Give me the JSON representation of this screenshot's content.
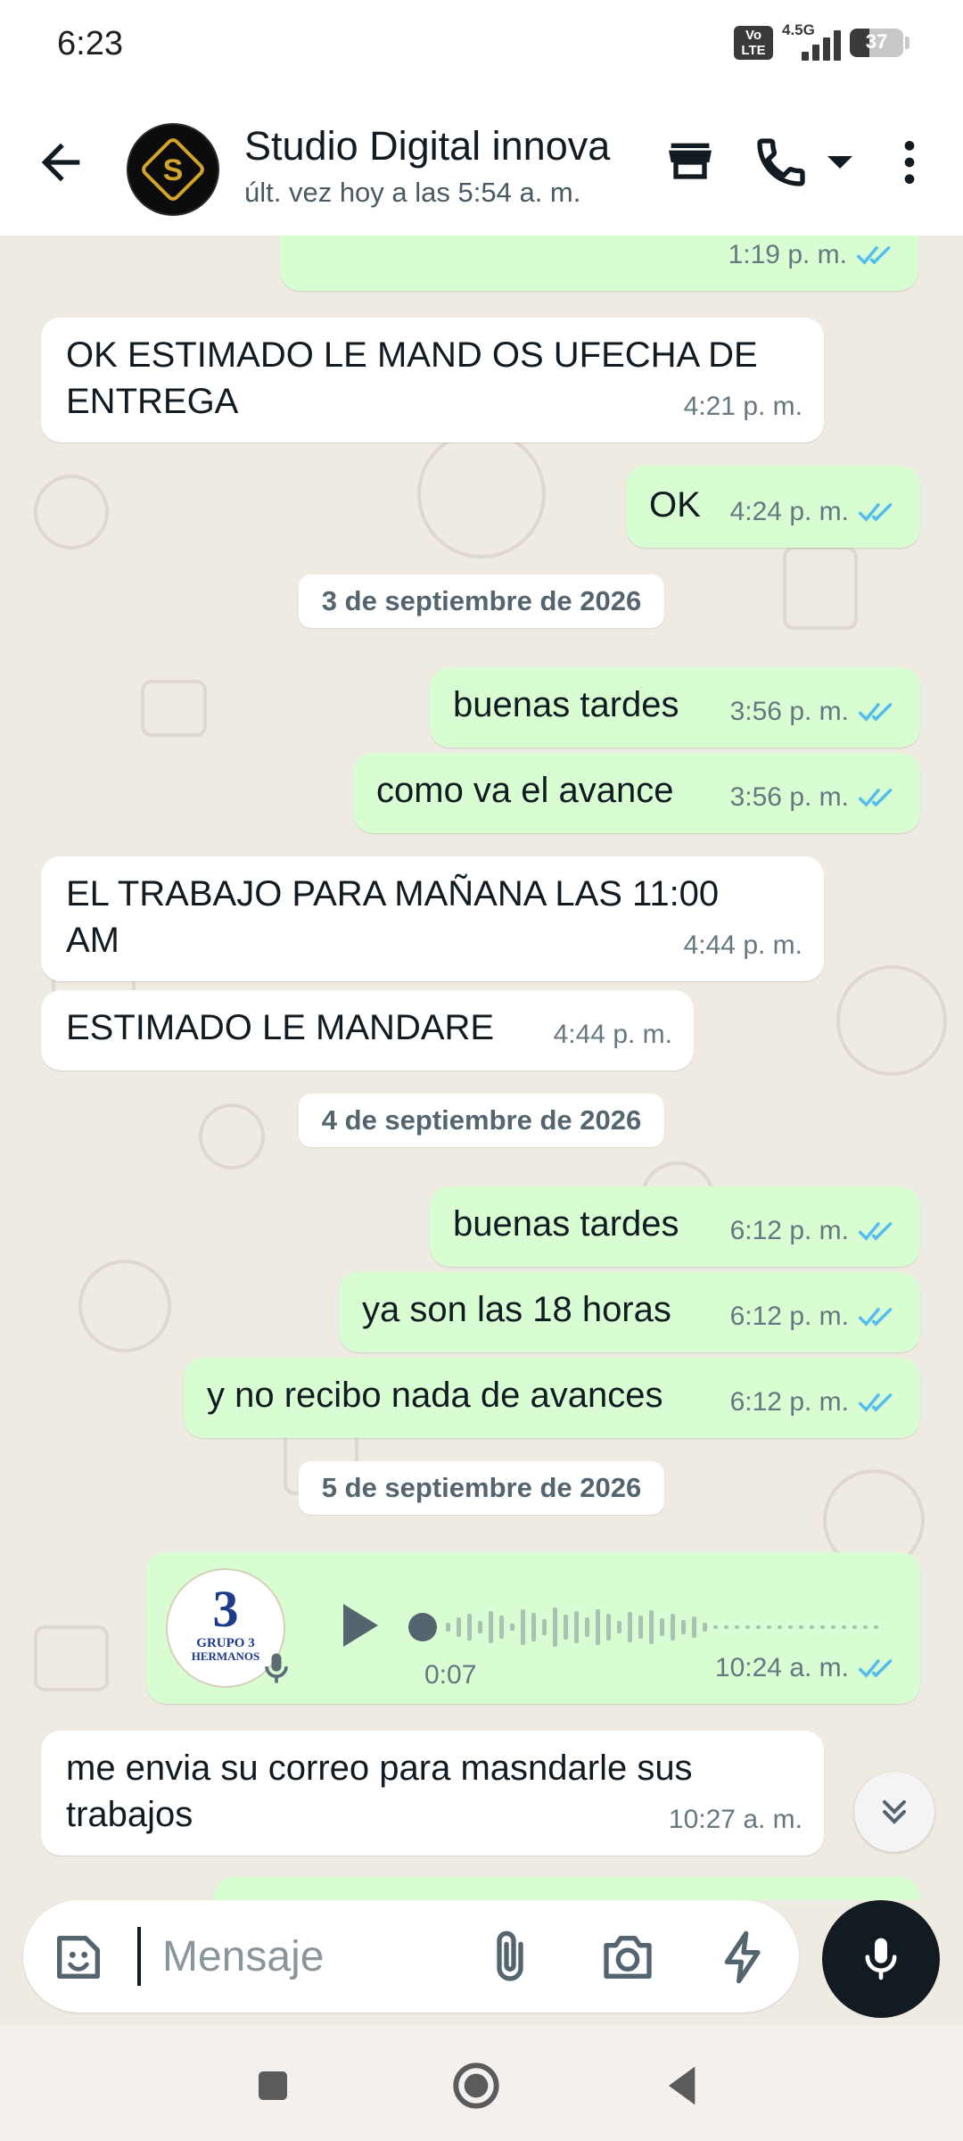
{
  "status_bar": {
    "time": "6:23",
    "volte": "Vo\nLTE",
    "network": "4.5G",
    "battery_level": "37"
  },
  "header": {
    "contact_name": "Studio Digital innova",
    "last_seen": "últ. vez hoy a las 5:54 a. m.",
    "avatar_letter": "S"
  },
  "chat": {
    "messages": [
      {
        "direction": "out",
        "text": "",
        "time": "1:19 p. m.",
        "read": true
      },
      {
        "direction": "in",
        "text": "OK ESTIMADO LE MAND OS UFECHA DE",
        "text2": "ENTREGA",
        "time": "4:21 p. m."
      },
      {
        "direction": "out",
        "text": "OK",
        "time": "4:24 p. m.",
        "read": true
      },
      {
        "date": "3 de septiembre de 2026"
      },
      {
        "direction": "out",
        "text": "buenas tardes",
        "time": "3:56 p. m.",
        "read": true
      },
      {
        "direction": "out",
        "text": "como va el avance",
        "time": "3:56 p. m.",
        "read": true
      },
      {
        "direction": "in",
        "text": "EL TRABAJO PARA MAÑANA LAS 11:00",
        "text2": "AM",
        "time": "4:44 p. m."
      },
      {
        "direction": "in",
        "text": "ESTIMADO LE MANDARE",
        "time": "4:44 p. m."
      },
      {
        "date": "4 de septiembre de 2026"
      },
      {
        "direction": "out",
        "text": "buenas tardes",
        "time": "6:12 p. m.",
        "read": true
      },
      {
        "direction": "out",
        "text": "ya son las 18 horas",
        "time": "6:12 p. m.",
        "read": true
      },
      {
        "direction": "out",
        "text": "y no recibo nada de avances",
        "time": "6:12 p. m.",
        "read": true
      },
      {
        "date": "5 de septiembre de 2026"
      },
      {
        "direction": "out",
        "type": "voice",
        "duration": "0:07",
        "time": "10:24 a. m.",
        "read": true,
        "avatar_line1": "GRUPO 3",
        "avatar_line2": "HERMANOS",
        "avatar_big": "3"
      },
      {
        "direction": "in",
        "text": "me envia su correo para masndarle sus",
        "text2": "trabajos",
        "time": "10:27 a. m."
      }
    ]
  },
  "input": {
    "placeholder": "Mensaje"
  },
  "colors": {
    "outgoing_bubble": "#d9fdd3",
    "incoming_bubble": "#ffffff",
    "read_ticks": "#53bdeb",
    "chat_background": "#efeae2"
  },
  "icons": [
    "back-arrow-icon",
    "store-icon",
    "phone-icon",
    "dropdown-icon",
    "more-vert-icon",
    "sticker-icon",
    "attach-icon",
    "camera-icon",
    "lightning-icon",
    "mic-icon",
    "play-icon",
    "double-check-icon",
    "chevron-double-down-icon",
    "nav-recents-icon",
    "nav-home-icon",
    "nav-back-icon"
  ]
}
